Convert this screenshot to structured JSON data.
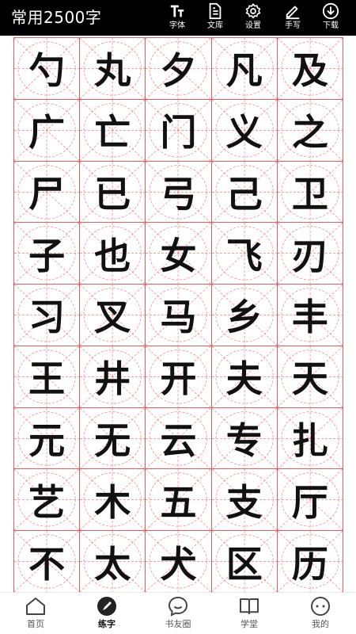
{
  "header": {
    "title": "常用2500字",
    "tools": [
      {
        "label": "字体",
        "icon": "font-icon"
      },
      {
        "label": "文库",
        "icon": "document-icon"
      },
      {
        "label": "设置",
        "icon": "gear-icon"
      },
      {
        "label": "手写",
        "icon": "pen-icon"
      },
      {
        "label": "下载",
        "icon": "download-icon"
      }
    ]
  },
  "characters": [
    "勺",
    "丸",
    "夕",
    "凡",
    "及",
    "广",
    "亡",
    "门",
    "义",
    "之",
    "尸",
    "已",
    "弓",
    "己",
    "卫",
    "子",
    "也",
    "女",
    "飞",
    "刃",
    "习",
    "叉",
    "马",
    "乡",
    "丰",
    "王",
    "井",
    "开",
    "夫",
    "天",
    "元",
    "无",
    "云",
    "专",
    "扎",
    "艺",
    "木",
    "五",
    "支",
    "厅",
    "不",
    "太",
    "犬",
    "区",
    "历"
  ],
  "nav": {
    "active": "练字",
    "items": [
      {
        "label": "首页",
        "icon": "home-icon"
      },
      {
        "label": "练字",
        "icon": "brush-icon"
      },
      {
        "label": "书友圈",
        "icon": "chat-icon"
      },
      {
        "label": "学堂",
        "icon": "book-icon"
      },
      {
        "label": "我的",
        "icon": "profile-icon"
      }
    ]
  },
  "colors": {
    "header_bg": "#000000",
    "grid_line": "#e06060",
    "guide_line": "#f08080",
    "char": "#111111"
  }
}
